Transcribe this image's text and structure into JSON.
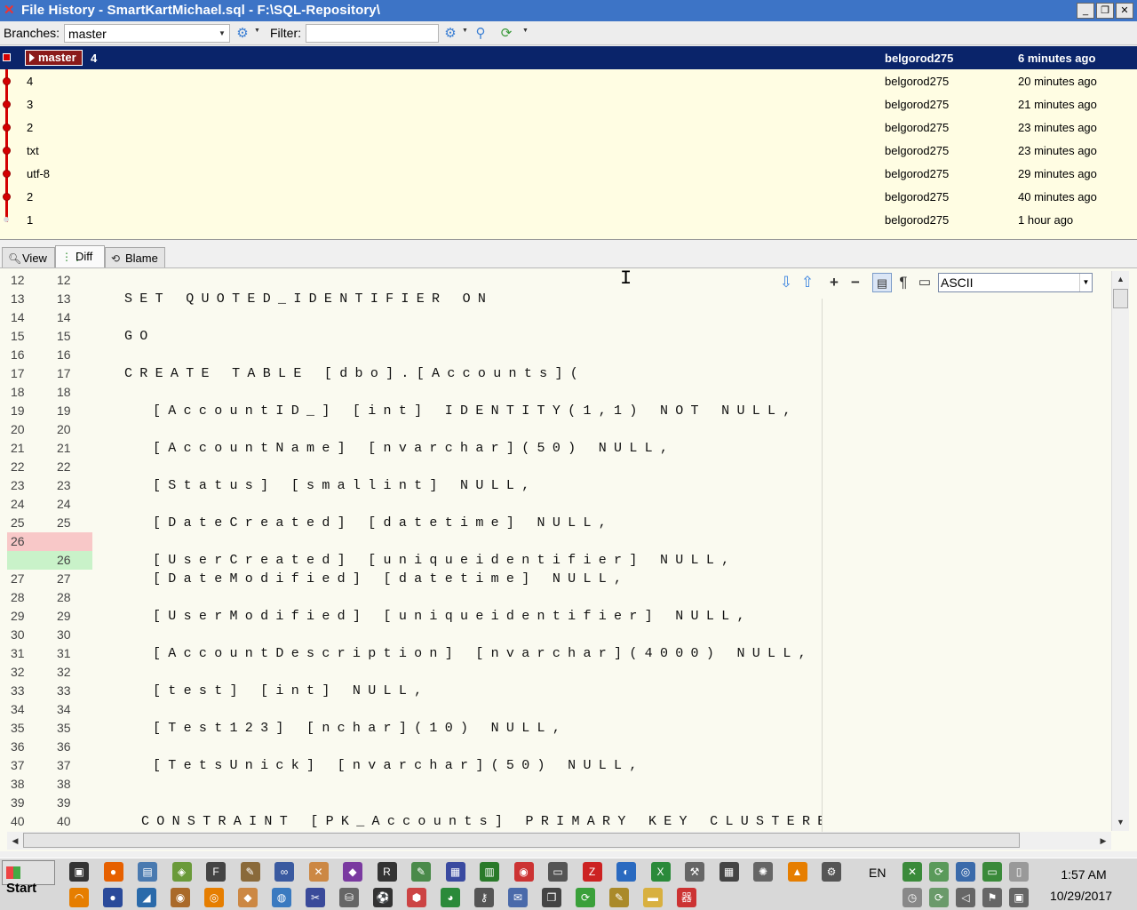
{
  "window": {
    "title": "File History - SmartKartMichael.sql - F:\\SQL-Repository\\",
    "minimize": "_",
    "maximize": "❐",
    "close": "✕"
  },
  "toolbar": {
    "branches_label": "Branches:",
    "branch_value": "master",
    "filter_label": "Filter:",
    "filter_value": ""
  },
  "history": {
    "head": {
      "branch_tag": "master",
      "message": "4",
      "author": "belgorod275",
      "date": "6 minutes ago"
    },
    "commits": [
      {
        "message": "4",
        "author": "belgorod275",
        "date": "20 minutes ago"
      },
      {
        "message": "3",
        "author": "belgorod275",
        "date": "21 minutes ago"
      },
      {
        "message": "2",
        "author": "belgorod275",
        "date": "23 minutes ago"
      },
      {
        "message": "txt",
        "author": "belgorod275",
        "date": "23 minutes ago"
      },
      {
        "message": "utf-8",
        "author": "belgorod275",
        "date": "29 minutes ago"
      },
      {
        "message": "2",
        "author": "belgorod275",
        "date": "40 minutes ago"
      },
      {
        "message": "1",
        "author": "belgorod275",
        "date": "1 hour ago"
      }
    ]
  },
  "tabs": [
    {
      "label": "View"
    },
    {
      "label": "Diff"
    },
    {
      "label": "Blame"
    }
  ],
  "diff": {
    "encoding": "ASCII",
    "lines": [
      {
        "left": "12",
        "right": "12",
        "code": "",
        "type": "same"
      },
      {
        "left": "13",
        "right": "13",
        "code": "SET QUOTED_IDENTIFIER ON",
        "type": "same"
      },
      {
        "left": "14",
        "right": "14",
        "code": "",
        "type": "same"
      },
      {
        "left": "15",
        "right": "15",
        "code": "GO",
        "type": "same"
      },
      {
        "left": "16",
        "right": "16",
        "code": "",
        "type": "same"
      },
      {
        "left": "17",
        "right": "17",
        "code": "CREATE TABLE [dbo].[Accounts](",
        "type": "same"
      },
      {
        "left": "18",
        "right": "18",
        "code": "",
        "type": "same"
      },
      {
        "left": "19",
        "right": "19",
        "code": "\t[AccountID_] [int] IDENTITY(1,1) NOT NULL,",
        "type": "same"
      },
      {
        "left": "20",
        "right": "20",
        "code": "",
        "type": "same"
      },
      {
        "left": "21",
        "right": "21",
        "code": "\t[AccountName] [nvarchar](50) NULL,",
        "type": "same"
      },
      {
        "left": "22",
        "right": "22",
        "code": "",
        "type": "same"
      },
      {
        "left": "23",
        "right": "23",
        "code": "\t[Status] [smallint] NULL,",
        "type": "same"
      },
      {
        "left": "24",
        "right": "24",
        "code": "",
        "type": "same"
      },
      {
        "left": "25",
        "right": "25",
        "code": "\t[DateCreated] [datetime] NULL,",
        "type": "same"
      },
      {
        "left": "26",
        "right": "",
        "code": "",
        "type": "del"
      },
      {
        "left": "",
        "right": "26",
        "code": "\t[UserCreated] [uniqueidentifier] NULL,",
        "type": "add"
      },
      {
        "left": "27",
        "right": "27",
        "code": "\t[DateModified] [datetime] NULL,",
        "type": "same"
      },
      {
        "left": "28",
        "right": "28",
        "code": "",
        "type": "same"
      },
      {
        "left": "29",
        "right": "29",
        "code": "\t[UserModified] [uniqueidentifier] NULL,",
        "type": "same"
      },
      {
        "left": "30",
        "right": "30",
        "code": "",
        "type": "same"
      },
      {
        "left": "31",
        "right": "31",
        "code": "\t[AccountDescription] [nvarchar](4000) NULL,",
        "type": "same"
      },
      {
        "left": "32",
        "right": "32",
        "code": "",
        "type": "same"
      },
      {
        "left": "33",
        "right": "33",
        "code": "\t[test] [int] NULL,",
        "type": "same"
      },
      {
        "left": "34",
        "right": "34",
        "code": "",
        "type": "same"
      },
      {
        "left": "35",
        "right": "35",
        "code": "\t[Test123] [nchar](10) NULL,",
        "type": "same"
      },
      {
        "left": "36",
        "right": "36",
        "code": "",
        "type": "same"
      },
      {
        "left": "37",
        "right": "37",
        "code": "\t[TetsUnick] [nvarchar](50) NULL,",
        "type": "same"
      },
      {
        "left": "38",
        "right": "38",
        "code": "",
        "type": "same"
      },
      {
        "left": "39",
        "right": "39",
        "code": "",
        "type": "same"
      },
      {
        "left": "40",
        "right": "40",
        "code": " CONSTRAINT [PK_Accounts] PRIMARY KEY CLUSTERED",
        "type": "same"
      }
    ]
  },
  "taskbar": {
    "start_label": "Start",
    "language": "EN",
    "time": "1:57 AM",
    "date": "10/29/2017"
  },
  "colors": {
    "titlebar": "#3d74c6",
    "selected_row": "#0a246a",
    "history_bg": "#fffde3",
    "graph": "#d40000",
    "deleted": "#f8c8c8",
    "added": "#c9f2c9"
  }
}
